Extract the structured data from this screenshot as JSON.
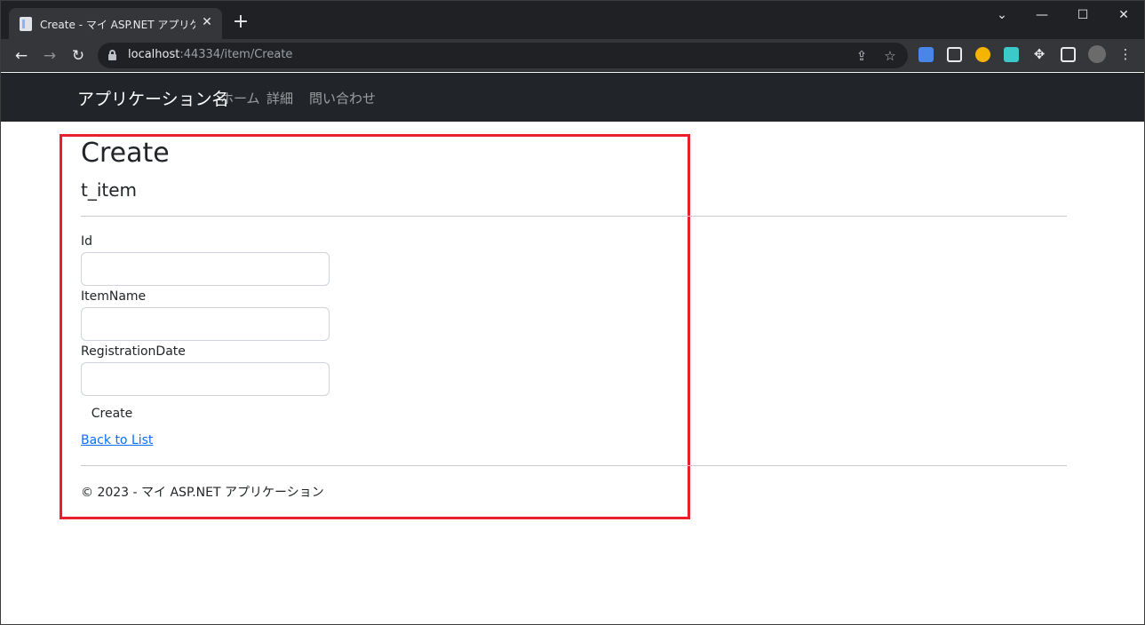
{
  "browser": {
    "tab_title": "Create - マイ ASP.NET アプリケーション",
    "tab_close_glyph": "✕",
    "new_tab_glyph": "+",
    "url_host": "localhost",
    "url_rest": ":44334/item/Create",
    "window_controls": {
      "chevron": "⌄",
      "minimize": "—",
      "maximize": "☐",
      "close": "✕"
    },
    "extension_colors": [
      "#4a86e8",
      "#e8eaed",
      "#f4b400",
      "#3cc9c9"
    ]
  },
  "navbar": {
    "brand": "アプリケーション名",
    "links": [
      "ホーム",
      "詳細",
      "問い合わせ"
    ]
  },
  "page": {
    "title": "Create",
    "entity": "t_item",
    "fields": [
      {
        "label": "Id",
        "value": ""
      },
      {
        "label": "ItemName",
        "value": ""
      },
      {
        "label": "RegistrationDate",
        "value": ""
      }
    ],
    "submit_label": "Create",
    "back_link": "Back to List",
    "footer": "© 2023 - マイ ASP.NET アプリケーション"
  },
  "colors": {
    "highlight_border": "#e8202a",
    "navbar_bg": "#212529",
    "link": "#0d6efd"
  }
}
